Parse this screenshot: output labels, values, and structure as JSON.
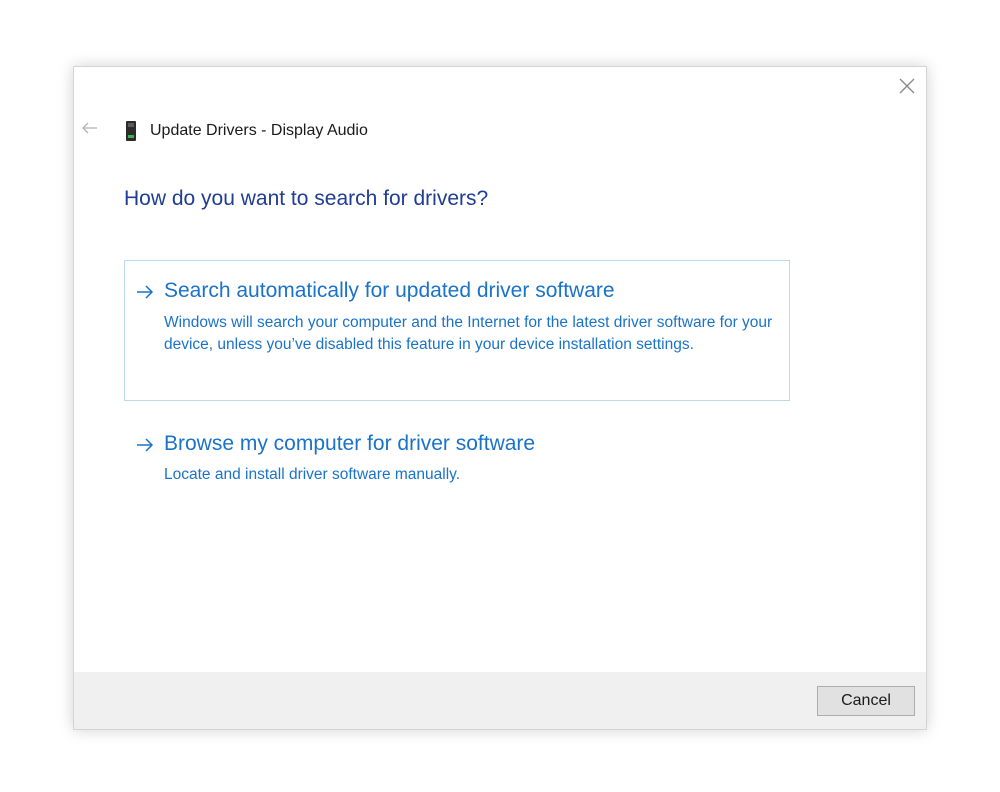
{
  "window": {
    "close_icon": "close-icon",
    "back_icon": "back-arrow-icon"
  },
  "header": {
    "device_icon": "audio-device-icon",
    "title": "Update Drivers - Display Audio"
  },
  "main": {
    "question": "How do you want to search for drivers?",
    "options": [
      {
        "icon": "arrow-right-icon",
        "title": "Search automatically for updated driver software",
        "description": "Windows will search your computer and the Internet for the latest driver software for your device, unless you’ve disabled this feature in your device installation settings.",
        "selected": true
      },
      {
        "icon": "arrow-right-icon",
        "title": "Browse my computer for driver software",
        "description": "Locate and install driver software manually.",
        "selected": false
      }
    ]
  },
  "footer": {
    "cancel_label": "Cancel"
  },
  "colors": {
    "heading": "#1f3d91",
    "link": "#1a73c9",
    "selected_border": "#bcd9ee",
    "footer_bg": "#f0f0f0"
  }
}
